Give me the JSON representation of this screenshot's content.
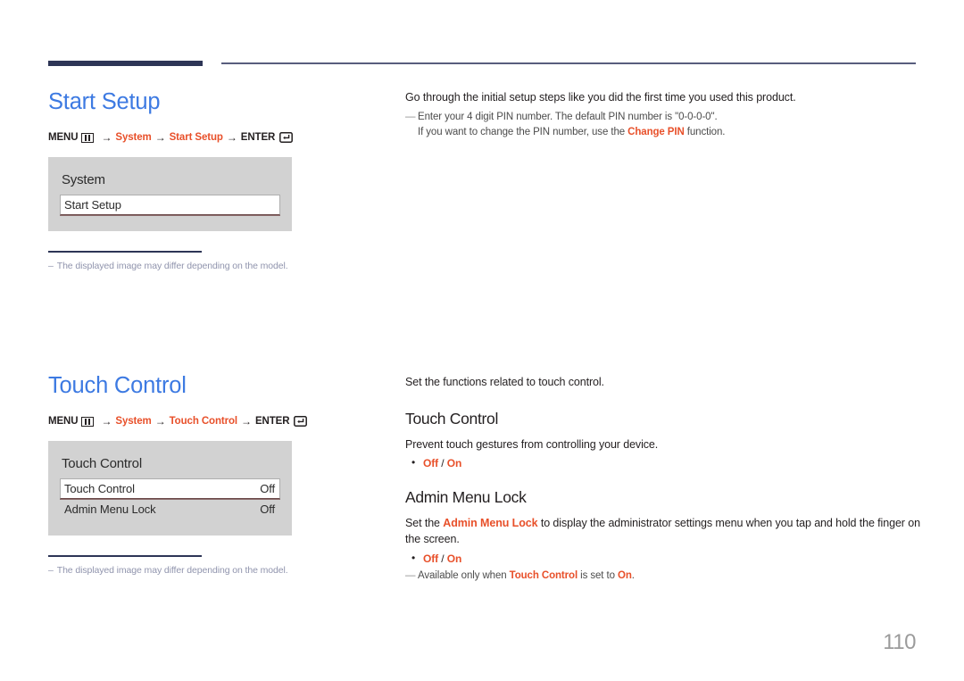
{
  "page": {
    "number": "110"
  },
  "sections": [
    {
      "id": "start-setup",
      "heading": "Start Setup",
      "menu_path": {
        "menu_label": "MENU",
        "menu_icon": "menu-grid-icon",
        "arrow": "→",
        "step1": "System",
        "step2": "Start Setup",
        "enter_label": "ENTER",
        "enter_icon": "enter-return-icon"
      },
      "osd": {
        "title": "System",
        "rows": [
          {
            "label": "Start Setup",
            "value": "",
            "selected": true
          }
        ]
      },
      "footnote": {
        "dash": "–",
        "text": "The displayed image may differ depending on the model."
      },
      "right": {
        "intro": "Go through the initial setup steps like you did the first time you used this product.",
        "note": {
          "tick": "—",
          "line1": "Enter your 4 digit PIN number. The default PIN number is \"0-0-0-0\".",
          "line2_pre": "If you want to change the PIN number, use the ",
          "line2_accent": "Change PIN",
          "line2_post": " function."
        }
      }
    },
    {
      "id": "touch-control",
      "heading": "Touch Control",
      "menu_path": {
        "menu_label": "MENU",
        "menu_icon": "menu-grid-icon",
        "arrow": "→",
        "step1": "System",
        "step2": "Touch Control",
        "enter_label": "ENTER",
        "enter_icon": "enter-return-icon"
      },
      "osd": {
        "title": "Touch Control",
        "rows": [
          {
            "label": "Touch Control",
            "value": "Off",
            "selected": true
          },
          {
            "label": "Admin Menu Lock",
            "value": "Off",
            "selected": false
          }
        ]
      },
      "footnote": {
        "dash": "–",
        "text": "The displayed image may differ depending on the model."
      },
      "right": {
        "intro": "Set the functions related to touch control.",
        "sub1": {
          "heading": "Touch Control",
          "desc": "Prevent touch gestures from controlling your device.",
          "options_off": "Off",
          "options_sep": " / ",
          "options_on": "On"
        },
        "sub2": {
          "heading": "Admin Menu Lock",
          "desc_pre": "Set the ",
          "desc_accent": "Admin Menu Lock",
          "desc_post": " to display the administrator settings menu when you tap and hold the finger on the screen.",
          "options_off": "Off",
          "options_sep": " / ",
          "options_on": "On",
          "note": {
            "tick": "—",
            "pre": "Available only when ",
            "accent1": "Touch Control",
            "mid": " is set to ",
            "accent2": "On",
            "post": "."
          }
        }
      }
    }
  ],
  "colors": {
    "heading_blue": "#3d7ae2",
    "accent_orange": "#e8502a",
    "rule_navy": "#2d3556",
    "osd_panel": "#d2d2d2",
    "footnote_gray": "#9094ad",
    "page_number_gray": "#9b9b9b"
  }
}
